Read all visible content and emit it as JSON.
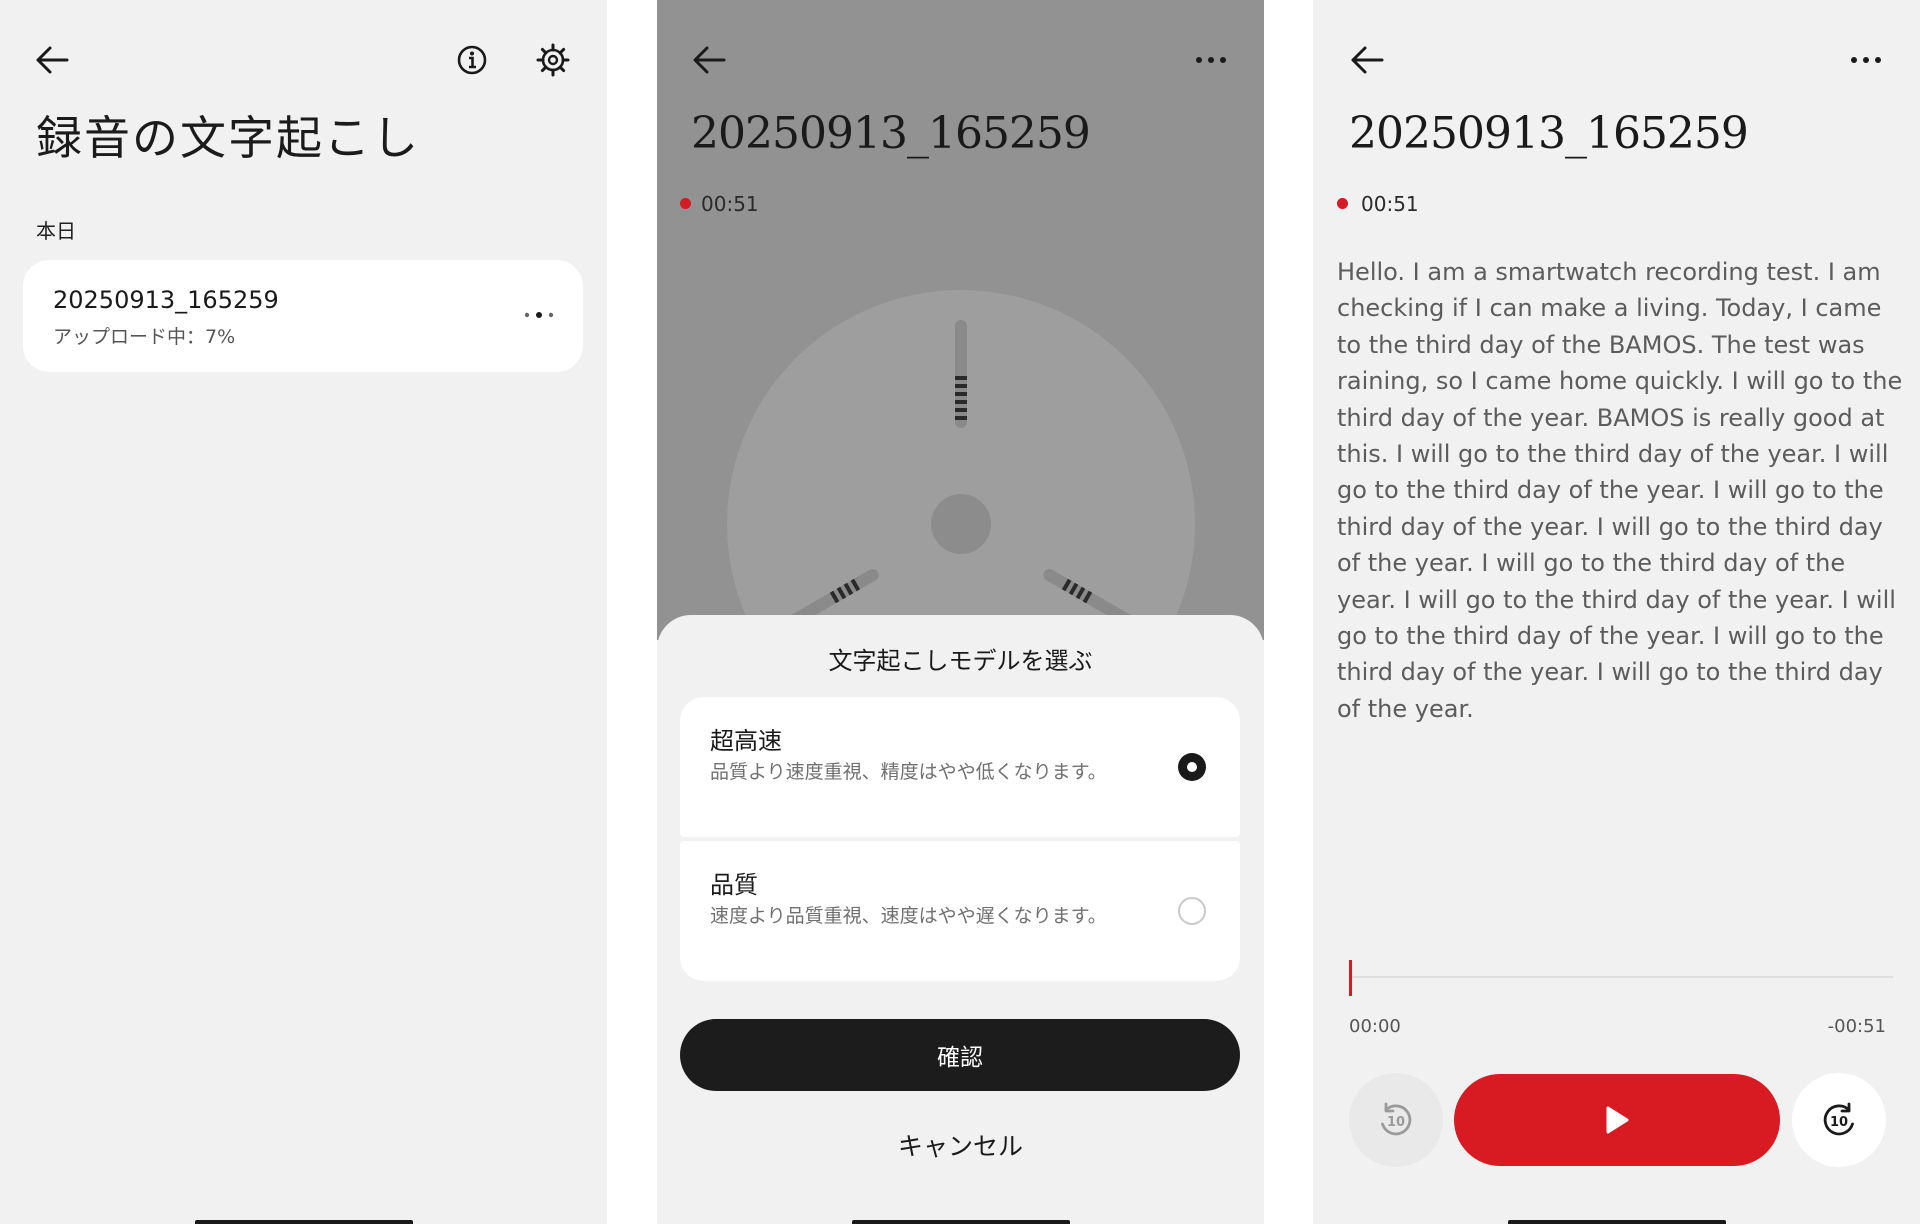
{
  "screen1": {
    "title": "録音の文字起こし",
    "section": "本日",
    "recording": {
      "name": "20250913_165259",
      "status": "アップロード中：7%"
    }
  },
  "screen2": {
    "title": "20250913_165259",
    "duration": "00:51",
    "sheet": {
      "title": "文字起こしモデルを選ぶ",
      "options": [
        {
          "name": "超高速",
          "desc": "品質より速度重視、精度はやや低くなります。",
          "selected": true
        },
        {
          "name": "品質",
          "desc": "速度より品質重視、速度はやや遅くなります。",
          "selected": false
        }
      ],
      "confirm": "確認",
      "cancel": "キャンセル"
    }
  },
  "screen3": {
    "title": "20250913_165259",
    "duration": "00:51",
    "transcript": "Hello. I am a smartwatch recording test. I am checking if I can make a living. Today, I came to the third day of the BAMOS. The test was raining, so I came home quickly. I will go to the third day of the year. BAMOS is really good at this. I will go to the third day of the year. I will go to the third day of the year. I will go to the third day of the year. I will go to the third day of the year. I will go to the third day of the year. I will go to the third day of the year. I will go to the third day of the year. I will go to the third day of the year. I will go to the third day of the year.",
    "time_start": "00:00",
    "time_remaining": "-00:51",
    "playback_progress": 0
  },
  "colors": {
    "accent": "#d81b23",
    "dark": "#1c1c1c",
    "background": "#f1f1f1"
  }
}
